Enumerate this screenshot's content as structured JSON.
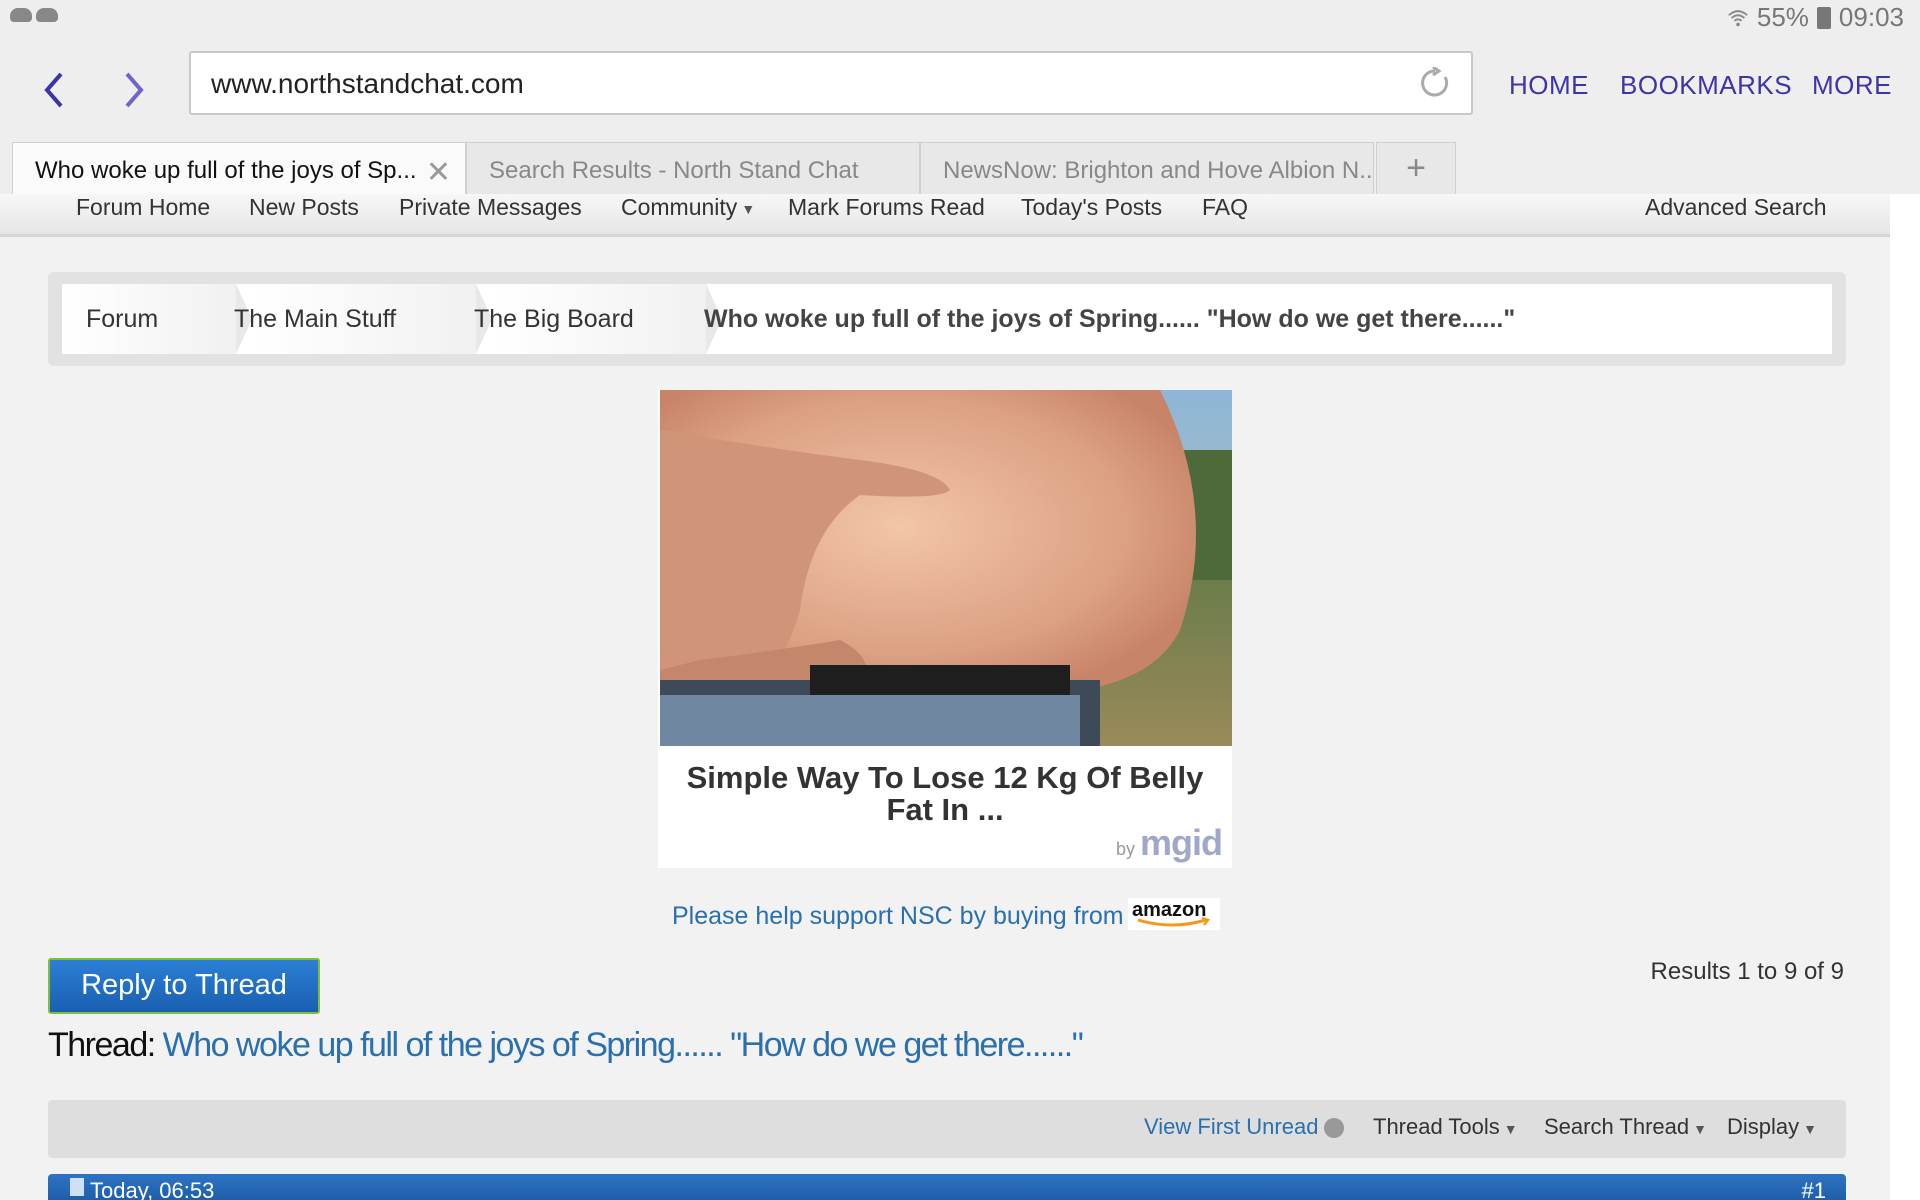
{
  "status_bar": {
    "battery": "55%",
    "time": "09:03"
  },
  "browser": {
    "url": "www.northstandchat.com",
    "links": [
      "HOME",
      "BOOKMARKS",
      "MORE"
    ],
    "tabs": [
      {
        "label": "Who woke up full of the joys of Sp...",
        "active": true
      },
      {
        "label": "Search Results - North Stand Chat",
        "active": false
      },
      {
        "label": "NewsNow: Brighton and Hove Albion N...",
        "active": false
      }
    ],
    "new_tab": "+"
  },
  "forum_nav": {
    "items": [
      "Forum Home",
      "New Posts",
      "Private Messages",
      "Community",
      "Mark Forums Read",
      "Today's Posts",
      "FAQ"
    ],
    "advanced_search": "Advanced Search"
  },
  "breadcrumb": {
    "items": [
      "Forum",
      "The Main Stuff",
      "The Big Board"
    ],
    "current": "Who woke up full of the joys of Spring...... \"How do we get there......\""
  },
  "ad": {
    "title": "Simple Way To Lose 12 Kg Of Belly Fat In ...",
    "by": "by",
    "brand": "mgid"
  },
  "support": {
    "text": "Please help support NSC by buying from",
    "logo": "amazon"
  },
  "thread": {
    "reply_button": "Reply to Thread",
    "results": "Results 1 to 9 of 9",
    "label": "Thread:",
    "title": "Who woke up full of the joys of Spring...... \"How do we get there......\"",
    "controls": {
      "view_first_unread": "View First Unread",
      "thread_tools": "Thread Tools",
      "search_thread": "Search Thread",
      "display": "Display"
    }
  },
  "post": {
    "date": "Today, 06:53",
    "number": "#1"
  },
  "colors": {
    "brand_link": "#3b35a8",
    "forum_link": "#2a6fae",
    "post_header": "#2d74c4"
  }
}
